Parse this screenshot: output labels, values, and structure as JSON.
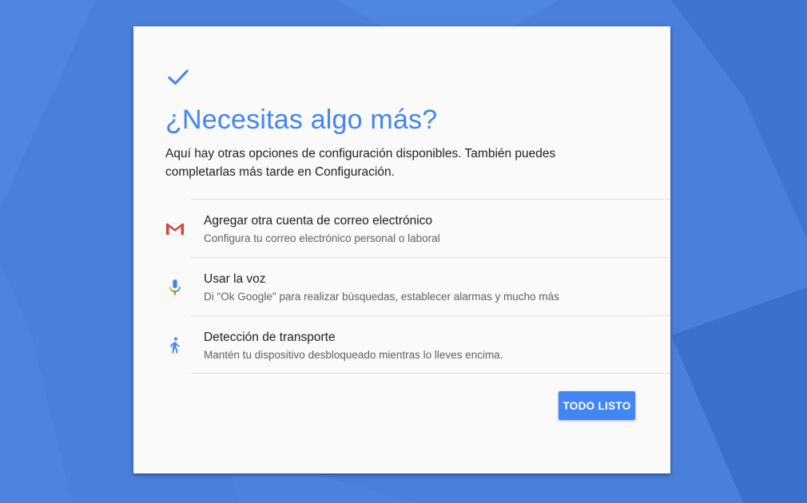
{
  "colors": {
    "background": "#4a7fdc",
    "accent": "#4285f4",
    "card": "#fafafa"
  },
  "header": {
    "icon": "check-icon",
    "title": "¿Necesitas algo más?",
    "description": "Aquí hay otras opciones de configuración disponibles. También puedes completarlas más tarde en Configuración."
  },
  "options": [
    {
      "icon": "gmail-icon",
      "title": "Agregar otra cuenta de correo electrónico",
      "subtitle": "Configura tu correo electrónico personal o laboral"
    },
    {
      "icon": "microphone-icon",
      "title": "Usar la voz",
      "subtitle": "Di \"Ok Google\" para realizar búsquedas, establecer alarmas y mucho más"
    },
    {
      "icon": "walking-person-icon",
      "title": "Detección de transporte",
      "subtitle": "Mantén tu dispositivo desbloqueado mientras lo lleves encima."
    }
  ],
  "actions": {
    "done_label": "TODO LISTO"
  }
}
